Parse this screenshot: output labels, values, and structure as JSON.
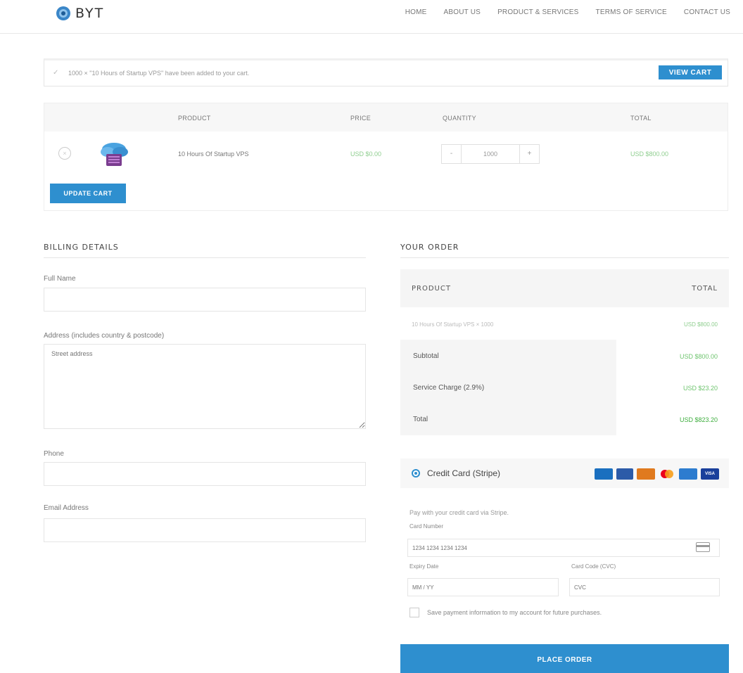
{
  "header": {
    "logo_text": "BYT",
    "nav": [
      "HOME",
      "ABOUT US",
      "PRODUCT & SERVICES",
      "TERMS OF SERVICE",
      "CONTACT US"
    ]
  },
  "notice": {
    "text": "1000 × \"10 Hours of Startup VPS\" have been added to your cart.",
    "button": "VIEW CART"
  },
  "cart": {
    "headers": {
      "product": "PRODUCT",
      "price": "PRICE",
      "quantity": "QUANTITY",
      "total": "TOTAL"
    },
    "item": {
      "name": "10 Hours Of Startup VPS",
      "price": "USD $0.00",
      "quantity": "1000",
      "total": "USD $800.00"
    },
    "update_button": "UPDATE CART"
  },
  "billing": {
    "title": "BILLING DETAILS",
    "full_name_label": "Full Name",
    "address_label": "Address (includes country & postcode)",
    "address_placeholder": "Street address",
    "phone_label": "Phone",
    "email_label": "Email Address"
  },
  "order": {
    "title": "YOUR ORDER",
    "product_header": "PRODUCT",
    "total_header": "TOTAL",
    "line_name": "10 Hours Of Startup VPS × 1000",
    "line_total": "USD $800.00",
    "subtotal_label": "Subtotal",
    "subtotal_value": "USD $800.00",
    "service_label": "Service Charge (2.9%)",
    "service_value": "USD $23.20",
    "total_label": "Total",
    "total_value": "USD $823.20"
  },
  "payment": {
    "method_label": "Credit Card (Stripe)",
    "card_brands": [
      "Diners Club",
      "JCB",
      "Discover",
      "Mastercard",
      "American Express",
      "Visa"
    ],
    "description": "Pay with your credit card via Stripe.",
    "card_number_label": "Card Number",
    "card_number_placeholder": "1234 1234 1234 1234",
    "expiry_label": "Expiry Date",
    "expiry_placeholder": "MM / YY",
    "cvc_label": "Card Code (CVC)",
    "cvc_placeholder": "CVC",
    "save_label": "Save payment information to my account for future purchases.",
    "place_order": "PLACE ORDER"
  },
  "colors": {
    "accent": "#2e8fcf",
    "price_green": "#6ec46e"
  }
}
